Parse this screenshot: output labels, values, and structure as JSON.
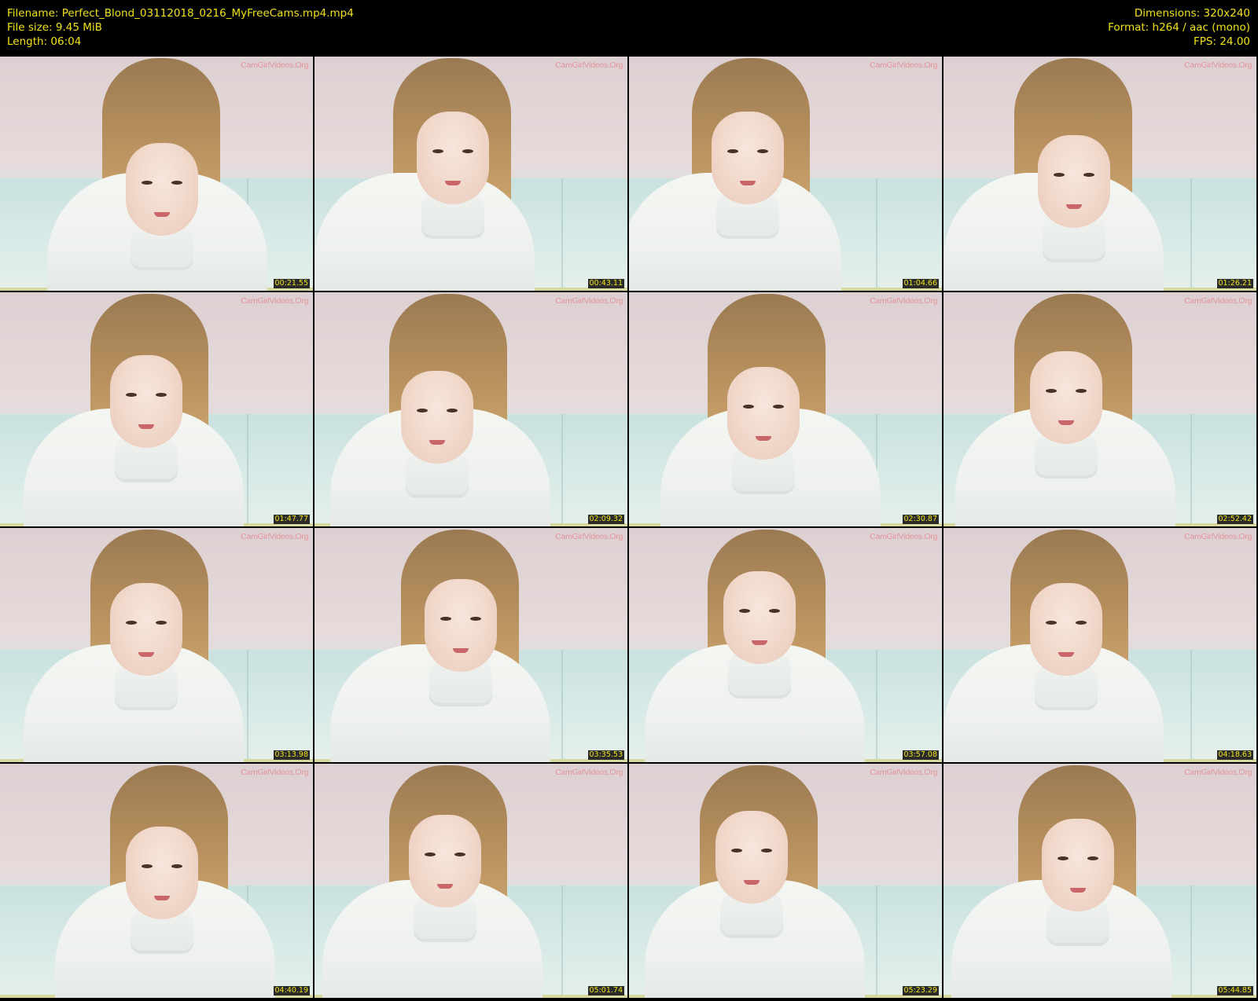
{
  "header": {
    "filename_label": "Filename: Perfect_Blond_03112018_0216_MyFreeCams.mp4.mp4",
    "filesize_label": "File size: 9.45 MiB",
    "length_label": "Length: 06:04",
    "dimensions_label": "Dimensions: 320x240",
    "format_label": "Format: h264 / aac (mono)",
    "fps_label": "FPS: 24.00"
  },
  "watermark": "CamGirlVideos.Org",
  "thumbnails": [
    {
      "timestamp": "00:21.55"
    },
    {
      "timestamp": "00:43.11"
    },
    {
      "timestamp": "01:04.66"
    },
    {
      "timestamp": "01:26.21"
    },
    {
      "timestamp": "01:47.77"
    },
    {
      "timestamp": "02:09.32"
    },
    {
      "timestamp": "02:30.87"
    },
    {
      "timestamp": "02:52.42"
    },
    {
      "timestamp": "03:13.98"
    },
    {
      "timestamp": "03:35.53"
    },
    {
      "timestamp": "03:57.08"
    },
    {
      "timestamp": "04:18.63"
    },
    {
      "timestamp": "04:40.19"
    },
    {
      "timestamp": "05:01.74"
    },
    {
      "timestamp": "05:23.29"
    },
    {
      "timestamp": "05:44.85"
    }
  ],
  "colors": {
    "header_background": "#000000",
    "header_text": "#f0e11a",
    "watermark": "#e58a92"
  }
}
